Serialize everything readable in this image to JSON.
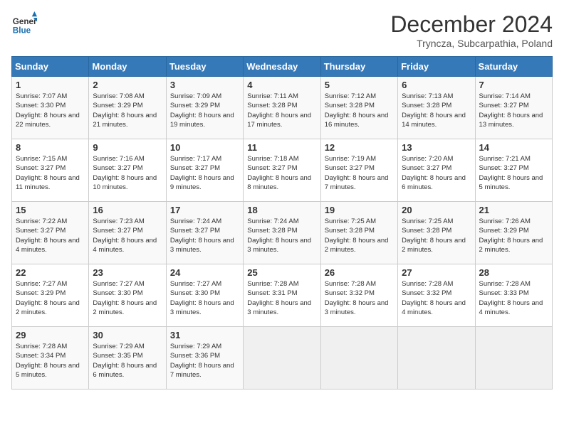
{
  "header": {
    "logo_line1": "General",
    "logo_line2": "Blue",
    "month_title": "December 2024",
    "location": "Tryncza, Subcarpathia, Poland"
  },
  "days_of_week": [
    "Sunday",
    "Monday",
    "Tuesday",
    "Wednesday",
    "Thursday",
    "Friday",
    "Saturday"
  ],
  "weeks": [
    [
      {
        "day": "1",
        "sunrise": "7:07 AM",
        "sunset": "3:30 PM",
        "daylight": "8 hours and 22 minutes."
      },
      {
        "day": "2",
        "sunrise": "7:08 AM",
        "sunset": "3:29 PM",
        "daylight": "8 hours and 21 minutes."
      },
      {
        "day": "3",
        "sunrise": "7:09 AM",
        "sunset": "3:29 PM",
        "daylight": "8 hours and 19 minutes."
      },
      {
        "day": "4",
        "sunrise": "7:11 AM",
        "sunset": "3:28 PM",
        "daylight": "8 hours and 17 minutes."
      },
      {
        "day": "5",
        "sunrise": "7:12 AM",
        "sunset": "3:28 PM",
        "daylight": "8 hours and 16 minutes."
      },
      {
        "day": "6",
        "sunrise": "7:13 AM",
        "sunset": "3:28 PM",
        "daylight": "8 hours and 14 minutes."
      },
      {
        "day": "7",
        "sunrise": "7:14 AM",
        "sunset": "3:27 PM",
        "daylight": "8 hours and 13 minutes."
      }
    ],
    [
      {
        "day": "8",
        "sunrise": "7:15 AM",
        "sunset": "3:27 PM",
        "daylight": "8 hours and 11 minutes."
      },
      {
        "day": "9",
        "sunrise": "7:16 AM",
        "sunset": "3:27 PM",
        "daylight": "8 hours and 10 minutes."
      },
      {
        "day": "10",
        "sunrise": "7:17 AM",
        "sunset": "3:27 PM",
        "daylight": "8 hours and 9 minutes."
      },
      {
        "day": "11",
        "sunrise": "7:18 AM",
        "sunset": "3:27 PM",
        "daylight": "8 hours and 8 minutes."
      },
      {
        "day": "12",
        "sunrise": "7:19 AM",
        "sunset": "3:27 PM",
        "daylight": "8 hours and 7 minutes."
      },
      {
        "day": "13",
        "sunrise": "7:20 AM",
        "sunset": "3:27 PM",
        "daylight": "8 hours and 6 minutes."
      },
      {
        "day": "14",
        "sunrise": "7:21 AM",
        "sunset": "3:27 PM",
        "daylight": "8 hours and 5 minutes."
      }
    ],
    [
      {
        "day": "15",
        "sunrise": "7:22 AM",
        "sunset": "3:27 PM",
        "daylight": "8 hours and 4 minutes."
      },
      {
        "day": "16",
        "sunrise": "7:23 AM",
        "sunset": "3:27 PM",
        "daylight": "8 hours and 4 minutes."
      },
      {
        "day": "17",
        "sunrise": "7:24 AM",
        "sunset": "3:27 PM",
        "daylight": "8 hours and 3 minutes."
      },
      {
        "day": "18",
        "sunrise": "7:24 AM",
        "sunset": "3:28 PM",
        "daylight": "8 hours and 3 minutes."
      },
      {
        "day": "19",
        "sunrise": "7:25 AM",
        "sunset": "3:28 PM",
        "daylight": "8 hours and 2 minutes."
      },
      {
        "day": "20",
        "sunrise": "7:25 AM",
        "sunset": "3:28 PM",
        "daylight": "8 hours and 2 minutes."
      },
      {
        "day": "21",
        "sunrise": "7:26 AM",
        "sunset": "3:29 PM",
        "daylight": "8 hours and 2 minutes."
      }
    ],
    [
      {
        "day": "22",
        "sunrise": "7:27 AM",
        "sunset": "3:29 PM",
        "daylight": "8 hours and 2 minutes."
      },
      {
        "day": "23",
        "sunrise": "7:27 AM",
        "sunset": "3:30 PM",
        "daylight": "8 hours and 2 minutes."
      },
      {
        "day": "24",
        "sunrise": "7:27 AM",
        "sunset": "3:30 PM",
        "daylight": "8 hours and 3 minutes."
      },
      {
        "day": "25",
        "sunrise": "7:28 AM",
        "sunset": "3:31 PM",
        "daylight": "8 hours and 3 minutes."
      },
      {
        "day": "26",
        "sunrise": "7:28 AM",
        "sunset": "3:32 PM",
        "daylight": "8 hours and 3 minutes."
      },
      {
        "day": "27",
        "sunrise": "7:28 AM",
        "sunset": "3:32 PM",
        "daylight": "8 hours and 4 minutes."
      },
      {
        "day": "28",
        "sunrise": "7:28 AM",
        "sunset": "3:33 PM",
        "daylight": "8 hours and 4 minutes."
      }
    ],
    [
      {
        "day": "29",
        "sunrise": "7:28 AM",
        "sunset": "3:34 PM",
        "daylight": "8 hours and 5 minutes."
      },
      {
        "day": "30",
        "sunrise": "7:29 AM",
        "sunset": "3:35 PM",
        "daylight": "8 hours and 6 minutes."
      },
      {
        "day": "31",
        "sunrise": "7:29 AM",
        "sunset": "3:36 PM",
        "daylight": "8 hours and 7 minutes."
      },
      null,
      null,
      null,
      null
    ]
  ],
  "labels": {
    "sunrise": "Sunrise:",
    "sunset": "Sunset:",
    "daylight": "Daylight:"
  }
}
